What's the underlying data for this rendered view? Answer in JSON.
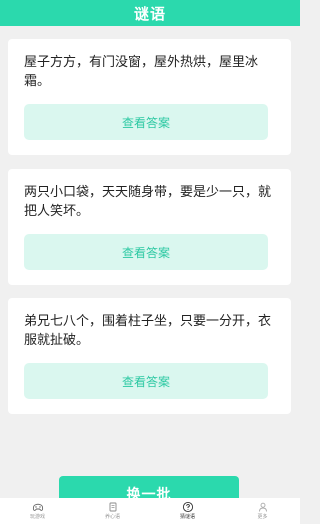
{
  "header": {
    "title": "谜语"
  },
  "riddles": [
    {
      "question": "屋子方方，有门没窗，屋外热烘，屋里冰霜。",
      "button_label": "查看答案"
    },
    {
      "question": "两只小口袋，天天随身带，要是少一只，就把人笑坏。",
      "button_label": "查看答案"
    },
    {
      "question": "弟兄七八个，围着柱子坐，只要一分开，衣服就扯破。",
      "button_label": "查看答案"
    }
  ],
  "switch_button": {
    "label": "换一批"
  },
  "tabbar": {
    "items": [
      {
        "label": "玩游戏",
        "icon": "gamepad-icon",
        "active": false
      },
      {
        "label": "养心语",
        "icon": "book-icon",
        "active": false
      },
      {
        "label": "猜谜语",
        "icon": "question-circle-icon",
        "active": true
      },
      {
        "label": "更多",
        "icon": "person-icon",
        "active": false
      }
    ]
  },
  "colors": {
    "accent": "#2bd9ad",
    "answer_button_bg": "#daf7ef",
    "answer_button_text": "#2dc9a3",
    "page_bg": "#f0f0f0"
  }
}
